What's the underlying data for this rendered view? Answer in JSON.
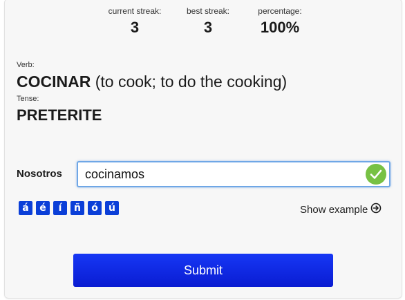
{
  "stats": {
    "current_streak_label": "current streak:",
    "current_streak_value": "3",
    "best_streak_label": "best streak:",
    "best_streak_value": "3",
    "percentage_label": "percentage:",
    "percentage_value": "100%"
  },
  "verb": {
    "label": "Verb:",
    "name": "COCINAR",
    "meaning": "(to cook; to do the cooking)"
  },
  "tense": {
    "label": "Tense:",
    "value": "PRETERITE"
  },
  "answer": {
    "pronoun": "Nosotros",
    "value": "cocinamos",
    "status_icon": "check-icon",
    "status_color": "#77c144"
  },
  "accents": [
    "á",
    "é",
    "í",
    "ñ",
    "ó",
    "ú"
  ],
  "show_example": {
    "label": "Show example",
    "icon": "arrow-circle-right-icon"
  },
  "submit_label": "Submit",
  "colors": {
    "accent_button": "#0b3fd8",
    "submit_button": "#0a1cd2",
    "input_focus_border": "#6fa7e6"
  }
}
